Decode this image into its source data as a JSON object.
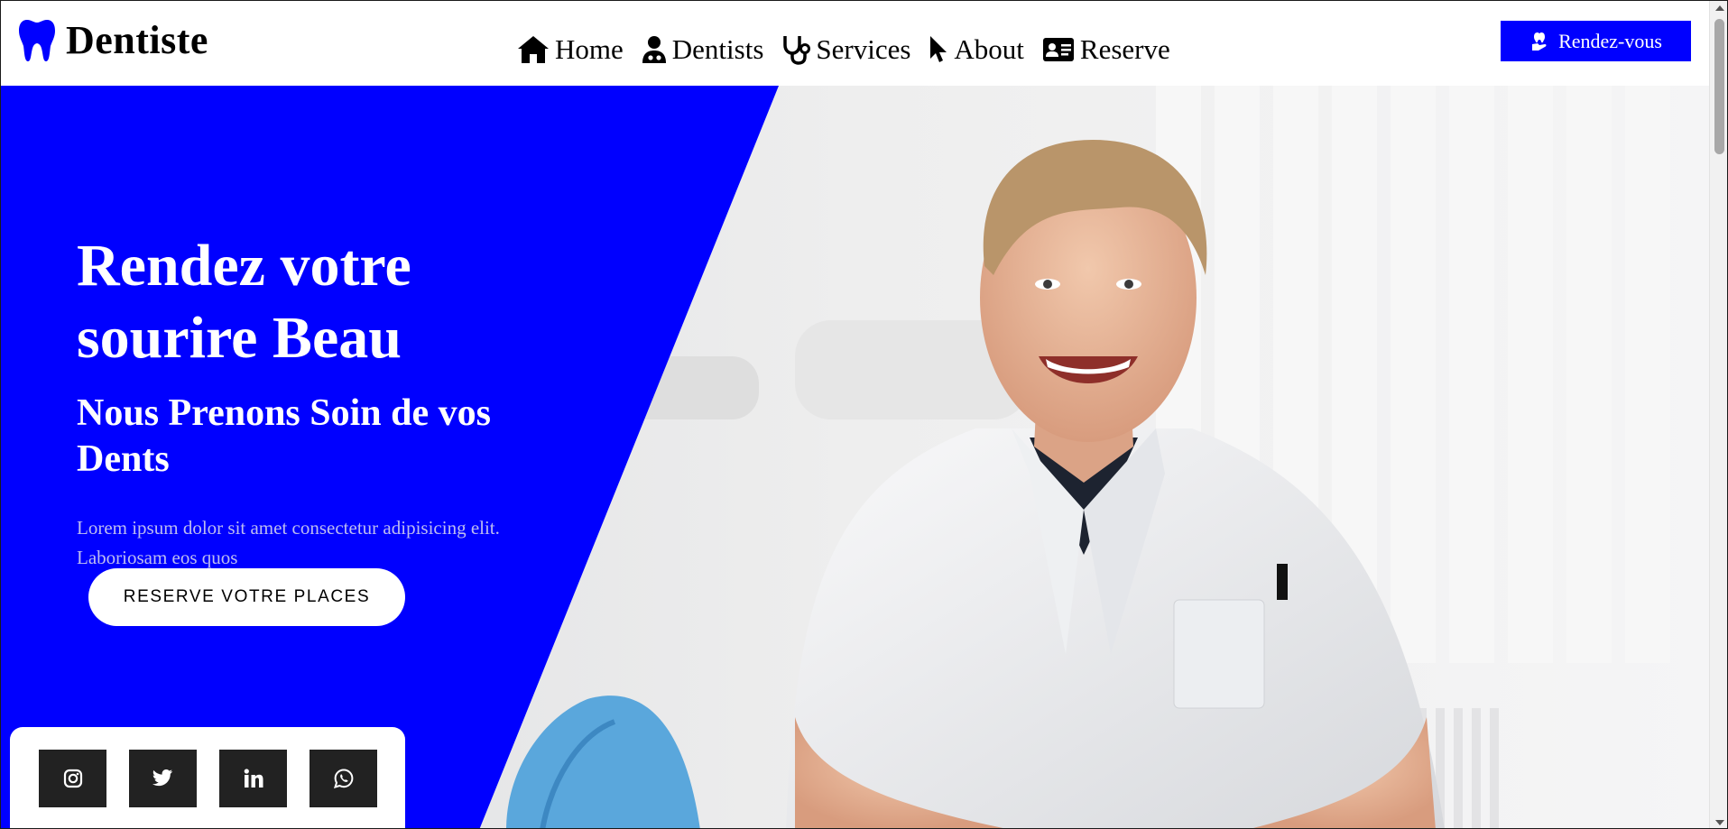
{
  "brand": {
    "name": "Dentiste",
    "logo_icon": "tooth-icon",
    "color": "#0000ff"
  },
  "nav": {
    "items": [
      {
        "label": "Home",
        "icon": "home-icon"
      },
      {
        "label": "Dentists",
        "icon": "user-doctor-icon"
      },
      {
        "label": "Services",
        "icon": "stethoscope-icon"
      },
      {
        "label": "About",
        "icon": "cursor-pointer-icon"
      },
      {
        "label": "Reserve",
        "icon": "id-card-icon"
      }
    ]
  },
  "header_cta": {
    "label": "Rendez-vous",
    "icon": "tooth-hand-icon",
    "color": "#0000ff"
  },
  "hero": {
    "title_line1": "Rendez votre",
    "title_line2": "sourire Beau",
    "subtitle": "Nous Prenons Soin de vos Dents",
    "text": "Lorem ipsum dolor sit amet consectetur adipisicing elit. Laboriosam eos quos",
    "cta_label": "RESERVE VOTRE PLACES",
    "panel_color": "#0000ff",
    "image": "smiling-dentist-photo"
  },
  "social": {
    "items": [
      {
        "name": "instagram",
        "icon": "instagram-icon"
      },
      {
        "name": "twitter",
        "icon": "twitter-icon"
      },
      {
        "name": "linkedin",
        "icon": "linkedin-icon"
      },
      {
        "name": "whatsapp",
        "icon": "whatsapp-icon"
      }
    ]
  }
}
